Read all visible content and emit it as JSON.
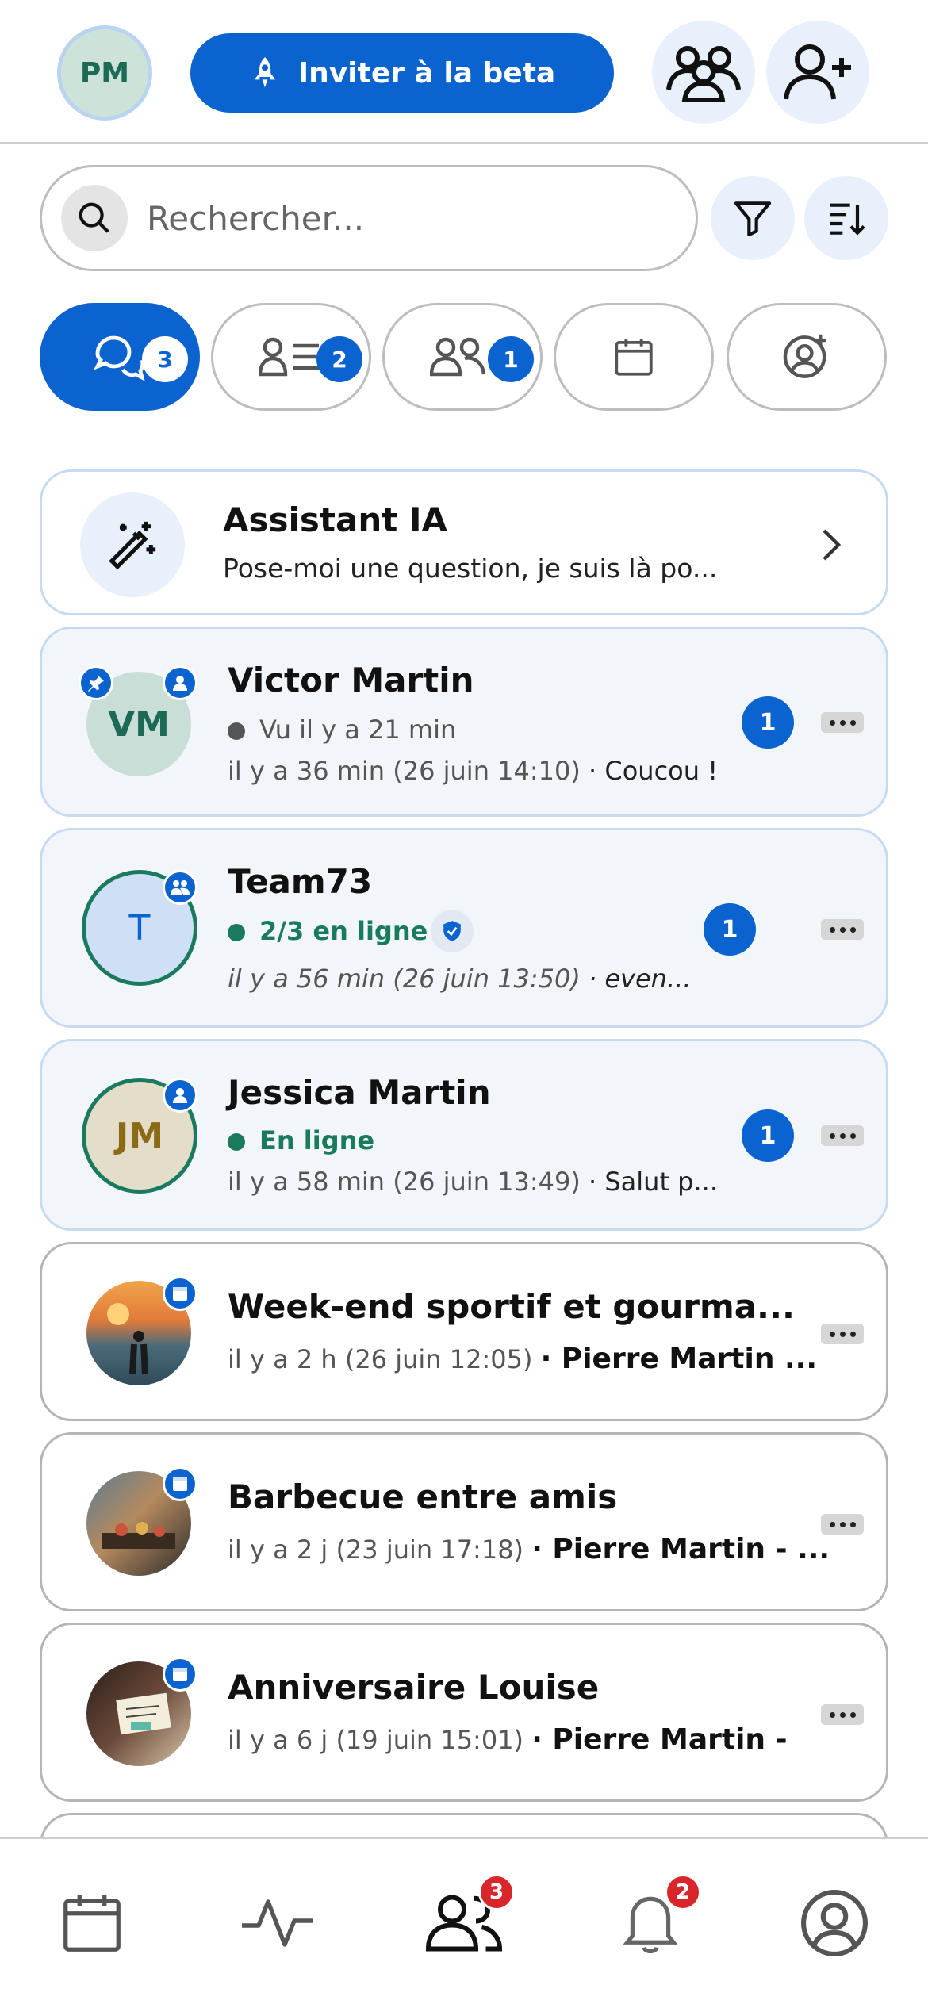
{
  "header": {
    "avatar_initials": "PM",
    "invite_label": "Inviter à la beta",
    "icons": [
      "rocket-icon",
      "group-icon",
      "add-user-icon"
    ]
  },
  "search": {
    "placeholder": "Rechercher..."
  },
  "tabs": [
    {
      "icon": "chats-icon",
      "badge": "3",
      "active": true
    },
    {
      "icon": "contact-list-icon",
      "badge": "2",
      "active": false
    },
    {
      "icon": "groups-icon",
      "badge": "1",
      "active": false
    },
    {
      "icon": "calendar-icon",
      "badge": "",
      "active": false
    },
    {
      "icon": "add-contact-icon",
      "badge": "",
      "active": false
    }
  ],
  "assistant": {
    "title": "Assistant IA",
    "subtitle": "Pose-moi une question, je suis là po..."
  },
  "conversations": [
    {
      "name": "Victor Martin",
      "initials": "VM",
      "status": "Vu il y a 21 min",
      "time": "il y a 36 min (26 juin 14:10)",
      "preview": "· Coucou !",
      "unread": "1"
    },
    {
      "name": "Team73",
      "initials": "T",
      "status": "2/3 en ligne",
      "time": "il y a 56 min (26 juin 13:50)",
      "preview": "· even...",
      "unread": "1"
    },
    {
      "name": "Jessica Martin",
      "initials": "JM",
      "status": "En ligne",
      "time": "il y a 58 min (26 juin 13:49)",
      "preview": "· Salut p...",
      "unread": "1"
    }
  ],
  "events": [
    {
      "title": "Week-end sportif et gourma...",
      "time": "il y a 2 h (26 juin 12:05)",
      "preview": "· Pierre Martin ..."
    },
    {
      "title": "Barbecue entre amis",
      "time": "il y a 2 j (23 juin 17:18)",
      "preview": "· Pierre Martin - ..."
    },
    {
      "title": "Anniversaire Louise",
      "time": "il y a 6 j (19 juin 15:01)",
      "preview": "· Pierre Martin -"
    }
  ],
  "bottom_nav": {
    "contacts_badge": "3",
    "notifications_badge": "2"
  },
  "colors": {
    "primary": "#0b63cf",
    "online": "#1a7a5e",
    "badge_red": "#d8262b"
  }
}
